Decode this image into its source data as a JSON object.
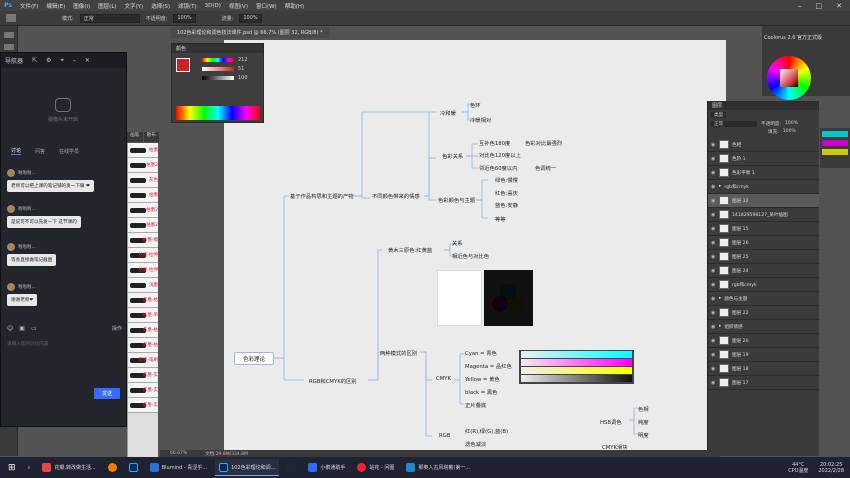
{
  "menubar": {
    "logo": "Ps",
    "items": [
      "文件(F)",
      "编辑(E)",
      "图像(I)",
      "图层(L)",
      "文字(Y)",
      "选择(S)",
      "滤镜(T)",
      "3D(D)",
      "视图(V)",
      "窗口(W)",
      "帮助(H)"
    ]
  },
  "optbar": {
    "mode_label": "模式:",
    "mode_value": "正常",
    "opacity_label": "不透明度:",
    "opacity_value": "100%",
    "flow_label": "流量:",
    "flow_value": "100%"
  },
  "doc_tab": "102色彩理论和调色技法课件.psd @ 66.7% (图层 32, RGB/8) *",
  "side_panel_title": "导航器",
  "chat": {
    "camera_text": "摄像头未开启",
    "tabs": [
      "讨论",
      "问答",
      "在线学员"
    ],
    "messages": [
      {
        "user": "啦啦啦...",
        "text": "老师可以把上课的笔记铺的发一下嘛 ❤"
      },
      {
        "user": "啦啦啦...",
        "text": "是说可不可以先发一下 这节课的"
      },
      {
        "user": "啦啦啦...",
        "text": "等会直接做笔记截图"
      },
      {
        "user": "啦啦啦...",
        "text": "谢谢老师❤"
      }
    ],
    "more_label": "操作",
    "input_placeholder": "请输入您的讨论内容",
    "send_label": "发送"
  },
  "thumbs": [
    "枯墨",
    "枯墨2",
    "灰色",
    "枯墨",
    "枯墨2",
    "枯墨2",
    "枯墨-擦",
    "枯墨-拉伸",
    "枯墨-拉伸",
    "浅墨",
    "焦墨-枯",
    "枯墨-单",
    "焦墨-枯",
    "焦墨-枯",
    "焦墨-笔刷",
    "焦墨-实",
    "焦墨-实",
    "焦墨-实"
  ],
  "thumbs_tabs": [
    "画笔",
    "散布"
  ],
  "color_panel": {
    "title": "颜色",
    "values": [
      "212",
      "51",
      "100"
    ]
  },
  "right_panel": {
    "title": "Coolorus 2.6 官方正式版"
  },
  "layers": {
    "title": "图层",
    "blend": "正常",
    "opacity_label": "不透明度:",
    "opacity": "100%",
    "fill_label": "填充:",
    "fill": "100%",
    "kind": "类型",
    "rows": [
      "色相",
      "色阶 1",
      "色彩平衡 1",
      "rgb和cmyk",
      "图层 32",
      "141829598127_某叶插图",
      "图层 15",
      "图层 26",
      "图层 25",
      "图层 24",
      "rgb和cmyk",
      "颜色与主题",
      "图层 22",
      "组织情感",
      "图层 20",
      "图层 19",
      "图层 18",
      "图层 17"
    ]
  },
  "status": {
    "zoom": "66.67%",
    "doc": "文档:29.8M/334.8M"
  },
  "mindmap": {
    "root": "色彩理论",
    "l1": [
      "基于作品构思和主题的产物",
      "RGB和CMYK的区别"
    ],
    "l2": [
      "不同颜色带来的情感",
      "两种模式的区别"
    ],
    "l3": [
      "冷和暖",
      "色彩关系",
      "色彩颜色与主题",
      "黄木三原色:红黄蓝",
      "CMYK",
      "RGB",
      "HSB调色"
    ],
    "leaves": [
      "色环",
      "冷暖相对",
      "互补色180度",
      "色彩对比最强烈",
      "对比色120度以上",
      "邻近色60度以内",
      "色调统一",
      "绿色:慢慢",
      "红色:喜庆",
      "蓝色:安静",
      "等等",
      "关系",
      "相近色与对比色",
      "Cyan = 青色",
      "Magenta = 品红色",
      "Yellow = 黄色",
      "black = 黑色",
      "正片叠底",
      "红(R),绿(G),蓝(B)",
      "滤色减淡",
      "色相",
      "纯度",
      "明度",
      "CMYK滑块"
    ]
  },
  "taskbar": {
    "items": [
      "花瓣,转改做生活...",
      "Blumind - 青涩乎...",
      "102色彩理论和调...",
      "小鹅通助手",
      "站花 - 问图",
      "那英入古风塔戴(第一..."
    ],
    "weather": "44°C",
    "weather_sub": "CPU温度",
    "time": "20:02:25",
    "date": "2022/2/28"
  },
  "colors": {
    "accent": "#31a8ff",
    "send": "#3a6bff",
    "heart": "#e23"
  }
}
